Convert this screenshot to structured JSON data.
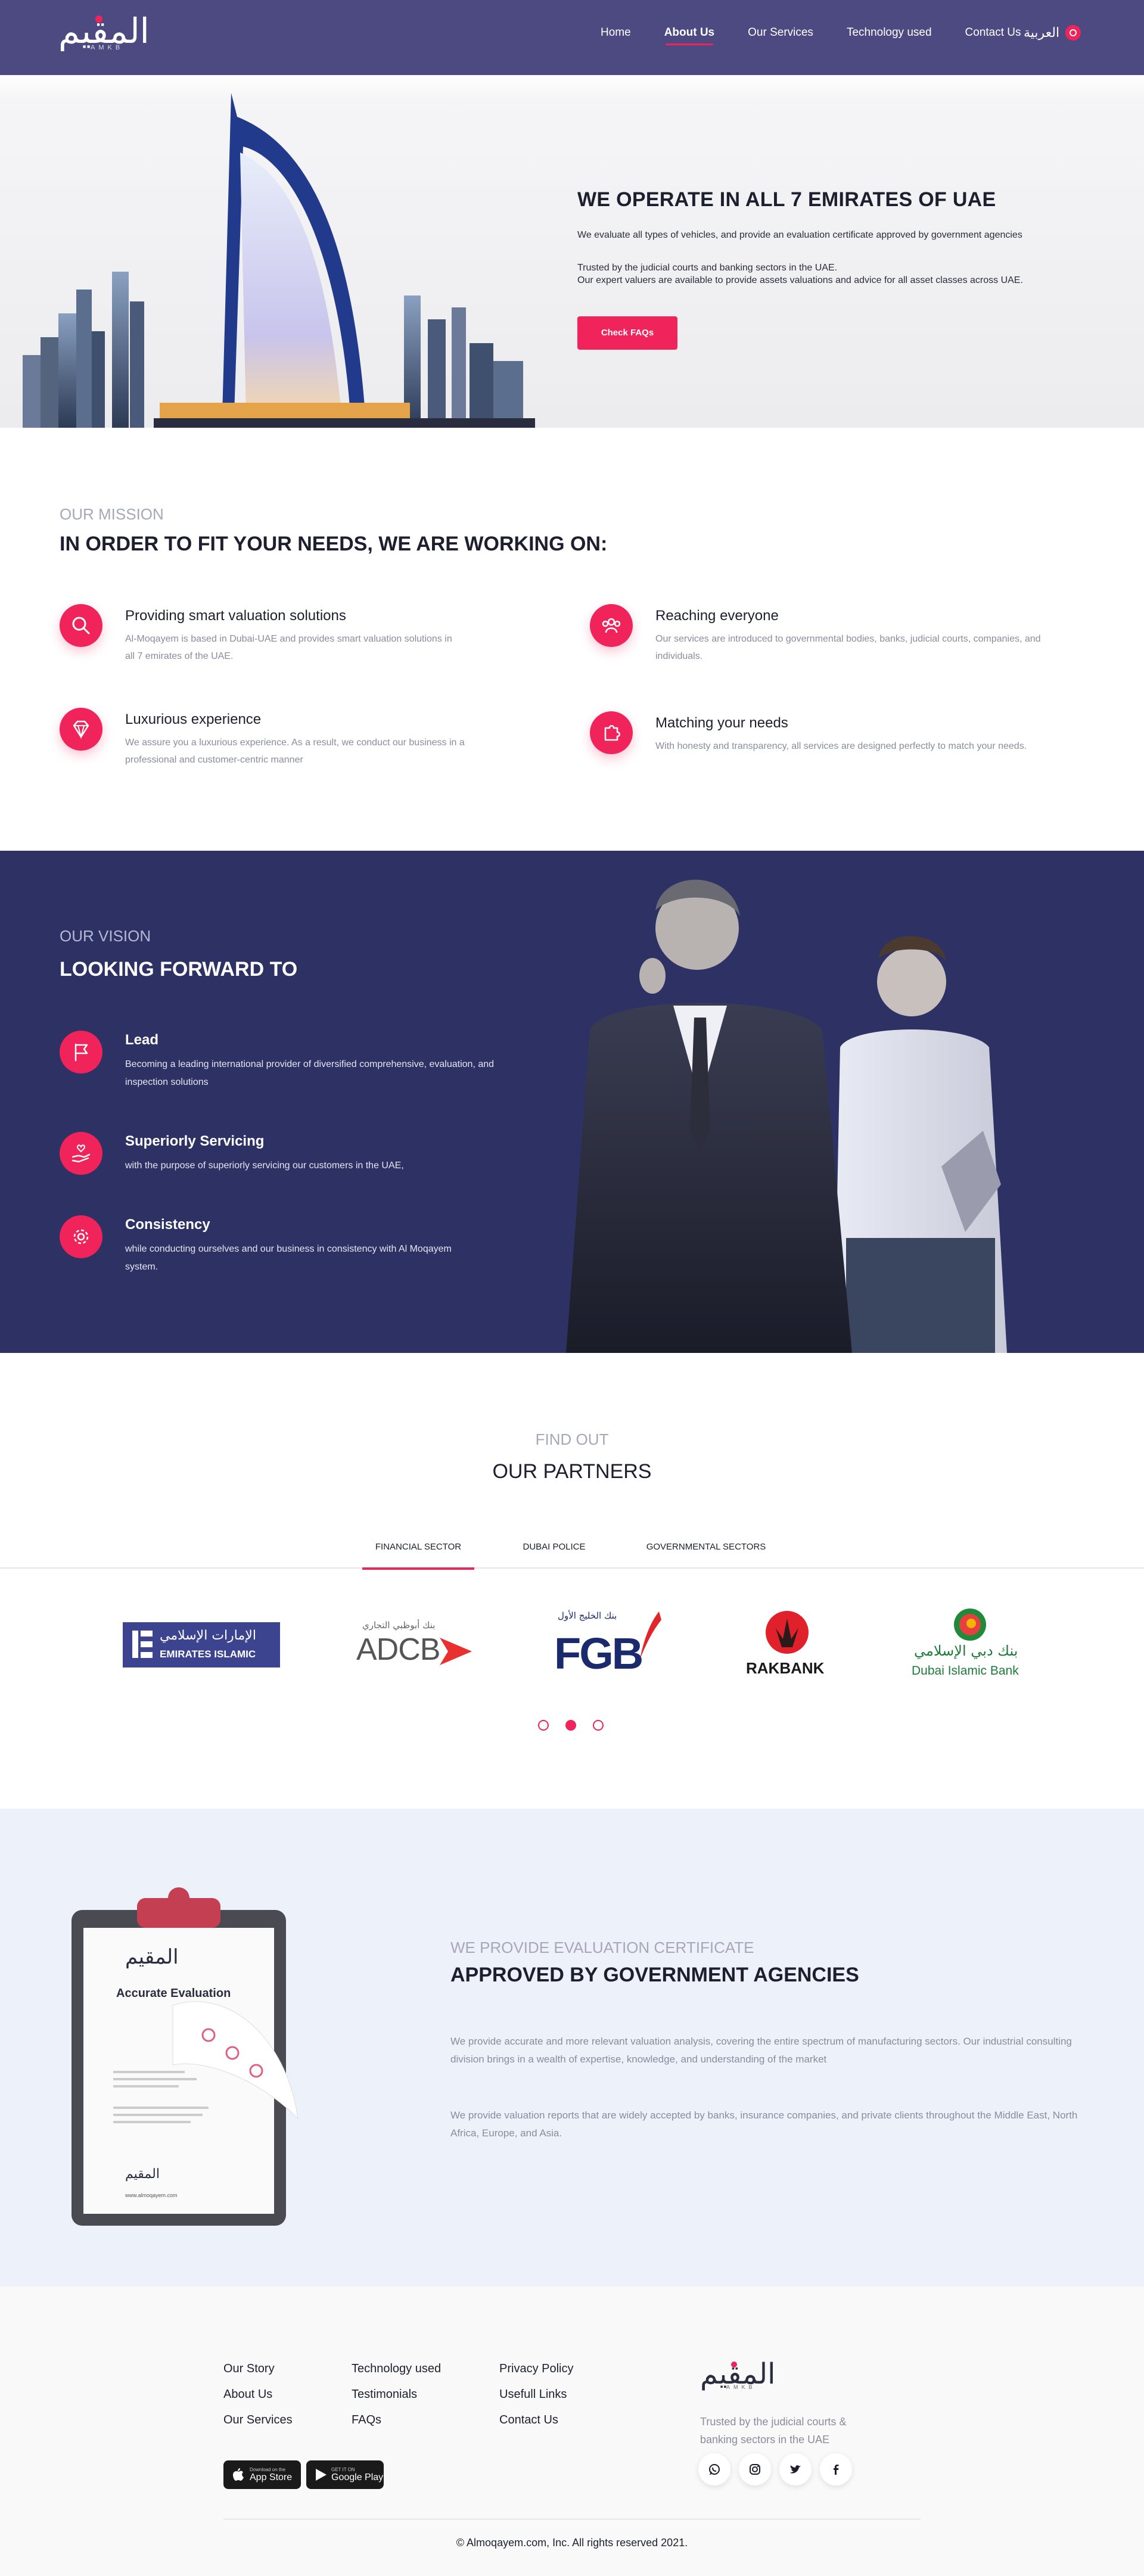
{
  "header": {
    "logo_text": "المقيم",
    "logo_sub": "AMKB",
    "nav": [
      "Home",
      "About Us",
      "Our Services",
      "Technology used",
      "Contact Us"
    ],
    "lang": "العربية"
  },
  "hero": {
    "title": "WE OPERATE IN ALL 7 EMIRATES OF UAE",
    "p1": "We evaluate all types of vehicles, and provide an evaluation certificate approved by government agencies",
    "p2_line1": "Trusted by the judicial courts and banking sectors in the UAE.",
    "p2_line2": "Our expert valuers are available to provide assets valuations and advice for all asset classes across UAE.",
    "button": "Check FAQs"
  },
  "mission": {
    "overline": "OUR MISSION",
    "title": "IN ORDER TO FIT YOUR NEEDS, WE ARE WORKING ON:",
    "features": [
      {
        "icon": "search-icon",
        "title": "Providing smart valuation solutions",
        "desc": "Al-Moqayem is based in Dubai-UAE and provides smart valuation solutions in all 7 emirates of the UAE."
      },
      {
        "icon": "group-icon",
        "title": "Reaching everyone",
        "desc": "Our services are introduced to governmental bodies, banks, judicial courts, companies, and individuals."
      },
      {
        "icon": "diamond-icon",
        "title": "Luxurious experience",
        "desc": "We assure you a luxurious experience. As a result, we conduct our business in a professional and customer-centric manner"
      },
      {
        "icon": "puzzle-icon",
        "title": "Matching your needs",
        "desc": "With honesty and transparency, all services are designed perfectly to match your needs."
      }
    ]
  },
  "vision": {
    "overline": "OUR VISION",
    "title": "LOOKING FORWARD TO",
    "items": [
      {
        "icon": "flag-icon",
        "title": "Lead",
        "desc": "Becoming a leading international provider of diversified comprehensive, evaluation, and inspection solutions"
      },
      {
        "icon": "hand-heart-icon",
        "title": "Superiorly Servicing",
        "desc": "with the purpose of superiorly servicing our customers in the UAE,"
      },
      {
        "icon": "gear-icon",
        "title": "Consistency",
        "desc": "while conducting ourselves and our business in consistency with Al Moqayem system."
      }
    ]
  },
  "partners": {
    "overline": "FIND OUT",
    "title": "OUR PARTNERS",
    "tabs": [
      "FINANCIAL SECTOR",
      "DUBAI POLICE",
      "GOVERNMENTAL SECTORS"
    ],
    "logos": [
      {
        "name": "EMIRATES ISLAMIC",
        "ar": "الإمارات الإسلامي"
      },
      {
        "name": "ADCB",
        "ar": "بنك أبوظبي التجاري"
      },
      {
        "name": "FGB",
        "ar": "بنك الخليج الأول"
      },
      {
        "name": "RAKBANK",
        "ar": "RAKBANK"
      },
      {
        "name": "Dubai Islamic Bank",
        "ar": "بنك دبي الإسلامي"
      }
    ]
  },
  "cert": {
    "overline": "WE PROVIDE EVALUATION CERTIFICATE",
    "title": "APPROVED BY GOVERNMENT AGENCIES",
    "p1": "We provide accurate and more relevant valuation analysis, covering the entire spectrum of manufacturing sectors. Our industrial consulting division brings in a wealth of expertise, knowledge, and understanding of the market",
    "p2": "We provide valuation reports that are widely accepted by banks, insurance companies, and private clients throughout the Middle East, North Africa, Europe, and Asia.",
    "doc_title": "Accurate Evaluation",
    "doc_url": "www.almoqayem.com"
  },
  "footer": {
    "col1": [
      "Our Story",
      "About Us",
      "Our Services"
    ],
    "col2": [
      "Technology used",
      "Testimonials",
      "FAQs"
    ],
    "col3": [
      "Privacy Policy",
      "Usefull Links",
      "Contact Us"
    ],
    "appstore_small": "Download on the",
    "appstore": "App Store",
    "play_small": "GET IT ON",
    "play": "Google Play",
    "tagline": "Trusted by the judicial courts & banking sectors in the UAE",
    "copyright": "© Almoqayem.com, Inc. All rights reserved 2021."
  },
  "colors": {
    "brand": "#4c4a80",
    "accent": "#f0245a",
    "vision_bg": "#2e3164",
    "cert_bg": "#edf1fa"
  }
}
